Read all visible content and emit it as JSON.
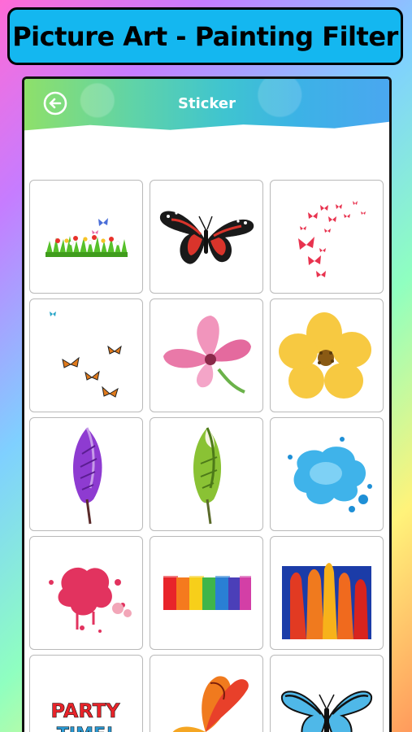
{
  "banner": {
    "title": "Picture Art - Painting Filter"
  },
  "appbar": {
    "title": "Sticker",
    "back_icon": "back-arrow-icon"
  },
  "stickers": [
    {
      "name": "grass-flowers-sticker"
    },
    {
      "name": "red-black-butterfly-sticker"
    },
    {
      "name": "red-butterflies-swarm-sticker"
    },
    {
      "name": "orange-butterflies-sticker"
    },
    {
      "name": "pink-flower-sticker"
    },
    {
      "name": "yellow-flower-sticker"
    },
    {
      "name": "purple-feather-sticker"
    },
    {
      "name": "green-feather-sticker"
    },
    {
      "name": "blue-splash-sticker"
    },
    {
      "name": "pink-splash-sticker"
    },
    {
      "name": "rainbow-brush-sticker"
    },
    {
      "name": "color-drip-sticker"
    },
    {
      "name": "party-time-sticker",
      "text": "PARTY TIME!"
    },
    {
      "name": "orange-butterfly-sticker"
    },
    {
      "name": "blue-butterfly-sticker"
    }
  ],
  "colors": {
    "banner": "#14b7f0",
    "appbar_start": "#8ee06a",
    "appbar_end": "#4aa7f0"
  }
}
